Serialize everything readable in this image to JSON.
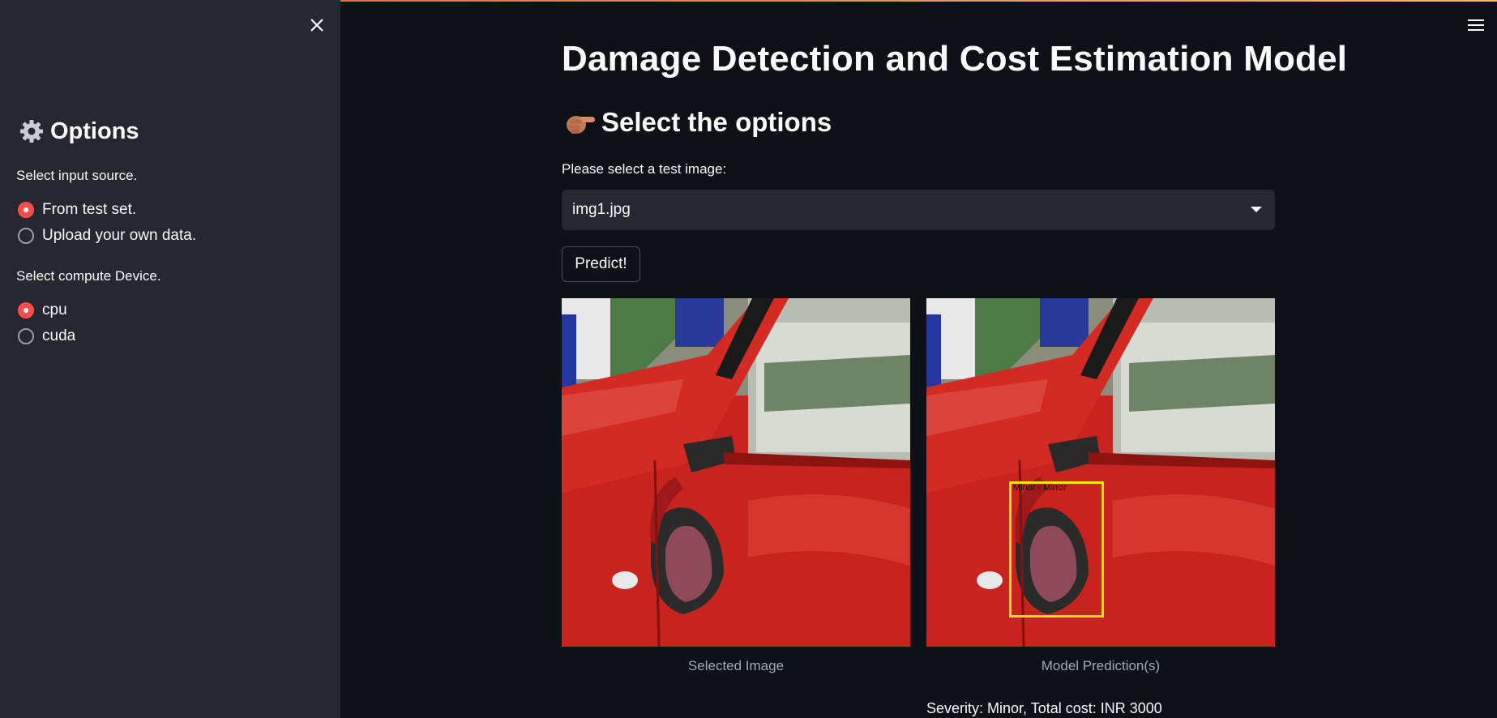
{
  "sidebar": {
    "title": "Options",
    "title_icon": "gear-icon",
    "input_source": {
      "label": "Select input source.",
      "options": [
        {
          "label": "From test set.",
          "selected": true
        },
        {
          "label": "Upload your own data.",
          "selected": false
        }
      ]
    },
    "device": {
      "label": "Select compute Device.",
      "options": [
        {
          "label": "cpu",
          "selected": true
        },
        {
          "label": "cuda",
          "selected": false
        }
      ]
    }
  },
  "main": {
    "title": "Damage Detection and Cost Estimation Model",
    "subtitle": "Select the options",
    "subtitle_icon": "pointing-hand-icon",
    "select": {
      "label": "Please select a test image:",
      "value": "img1.jpg"
    },
    "predict_label": "Predict!",
    "images": [
      {
        "caption": "Selected Image"
      },
      {
        "caption": "Model Prediction(s)",
        "detection_label": "Minor - Mirror"
      }
    ],
    "result": "Severity: Minor, Total cost: INR 3000"
  },
  "colors": {
    "accent": "#ff4b4b",
    "background": "#0e1117",
    "sidebar": "#262730",
    "bbox": "#f5e700"
  }
}
